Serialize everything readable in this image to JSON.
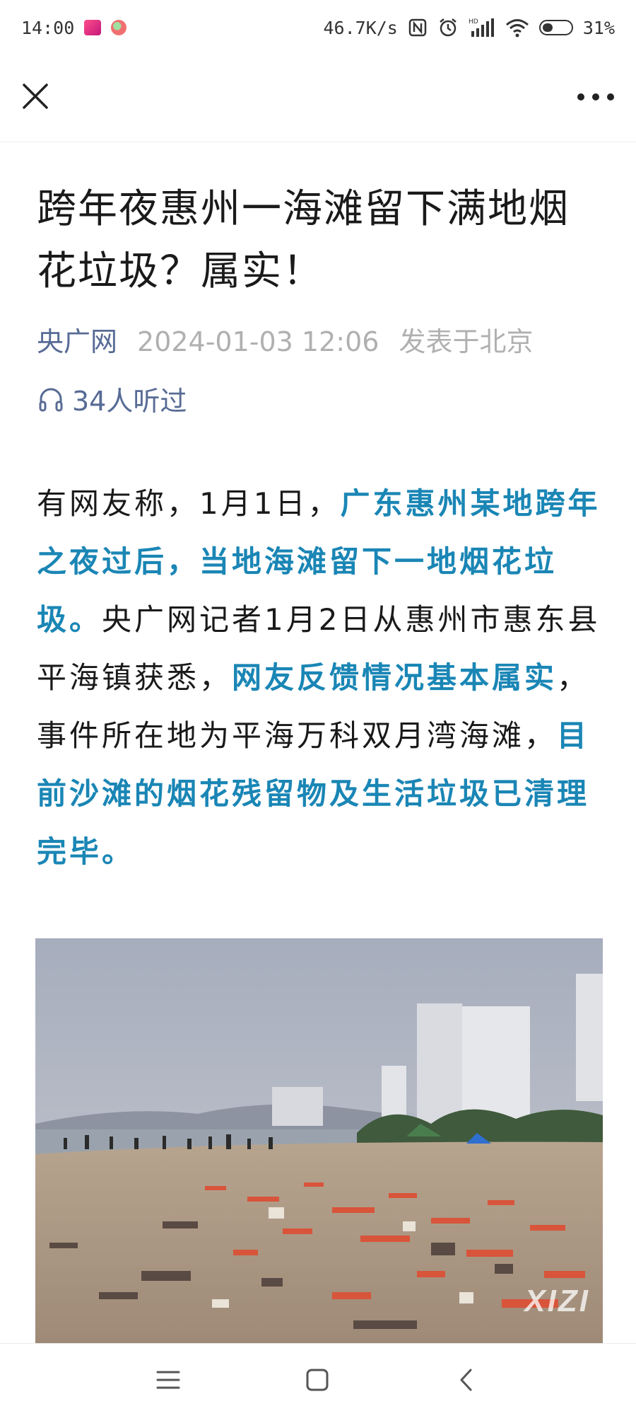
{
  "status_bar": {
    "time": "14:00",
    "net_speed": "46.7K/s",
    "battery": "31%"
  },
  "header": {
    "close_icon": "close-icon",
    "more_icon": "more-horizontal-icon"
  },
  "article": {
    "title": "跨年夜惠州一海滩留下满地烟花垃圾？属实！",
    "source": "央广网",
    "datetime": "2024-01-03 12:06",
    "location": "发表于北京",
    "listen_count": "34人听过",
    "paragraph": [
      {
        "text": "有网友称，1月1日，",
        "highlight": false
      },
      {
        "text": "广东惠州某地跨年之夜过后，当地海滩留下一地烟花垃圾。",
        "highlight": true
      },
      {
        "text": "央广网记者1月2日从惠州市惠东县平海镇获悉，",
        "highlight": false
      },
      {
        "text": "网友反馈情况基本属实",
        "highlight": true
      },
      {
        "text": "，事件所在地为平海万科双月湾海滩，",
        "highlight": false
      },
      {
        "text": "目前沙滩的烟花残留物及生活垃圾已清理完毕。",
        "highlight": true
      }
    ],
    "image_watermark": "XIZI"
  },
  "colors": {
    "link": "#576b95",
    "highlight": "#1a86b5",
    "meta_gray": "#b0b0b0"
  }
}
